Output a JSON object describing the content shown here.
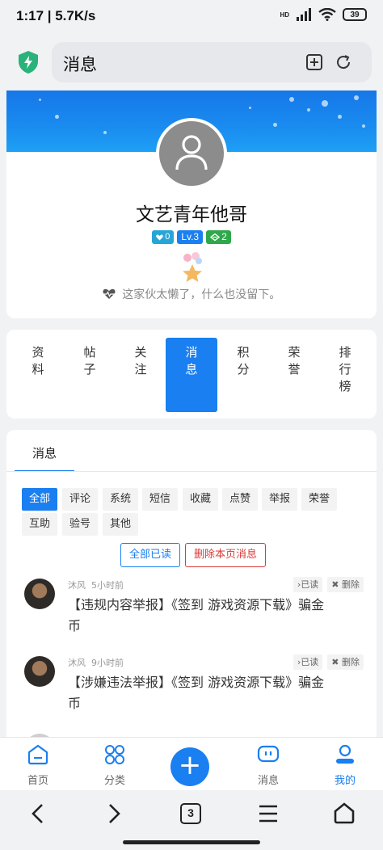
{
  "status_bar": {
    "time": "1:17 | 5.7K/s",
    "network": "HD",
    "battery": "39"
  },
  "address_bar": {
    "title": "消息"
  },
  "profile": {
    "username": "文艺青年他哥",
    "badges": {
      "vip": "0",
      "level": "Lv.3",
      "points": "2"
    },
    "signature": "这家伙太懒了，什么也没留下。"
  },
  "tabs": [
    {
      "label": "资料",
      "active": false
    },
    {
      "label": "帖子",
      "active": false
    },
    {
      "label": "关注",
      "active": false
    },
    {
      "label": "消息",
      "active": true
    },
    {
      "label": "积分",
      "active": false
    },
    {
      "label": "荣誉",
      "active": false
    },
    {
      "label": "排行榜",
      "active": false
    }
  ],
  "messages": {
    "header": "消息",
    "filters": [
      "全部",
      "评论",
      "系统",
      "短信",
      "收藏",
      "点赞",
      "举报",
      "荣誉",
      "互助",
      "验号",
      "其他"
    ],
    "active_filter": "全部",
    "mark_all_read": "全部已读",
    "delete_page": "删除本页消息",
    "items": [
      {
        "user": "沐风",
        "time": "5小时前",
        "read_label": "已读",
        "delete_label": "删除",
        "text": "【违规内容举报】《签到 游戏资源下载》骗金币"
      },
      {
        "user": "沐风",
        "time": "9小时前",
        "read_label": "已读",
        "delete_label": "删除",
        "text": "【涉嫌违法举报】《签到 游戏资源下载》骗金币"
      }
    ]
  },
  "bottom_nav": [
    {
      "label": "首页",
      "icon": "home-icon"
    },
    {
      "label": "分类",
      "icon": "category-icon"
    },
    {
      "label": "消息",
      "icon": "message-icon"
    },
    {
      "label": "我的",
      "icon": "profile-icon"
    }
  ],
  "browser_toolbar": {
    "tab_count": "3"
  },
  "colors": {
    "accent": "#1a7ff0",
    "danger": "#d93b3b",
    "level_badge": "#1a7ff0",
    "points_badge": "#2ea84a"
  }
}
